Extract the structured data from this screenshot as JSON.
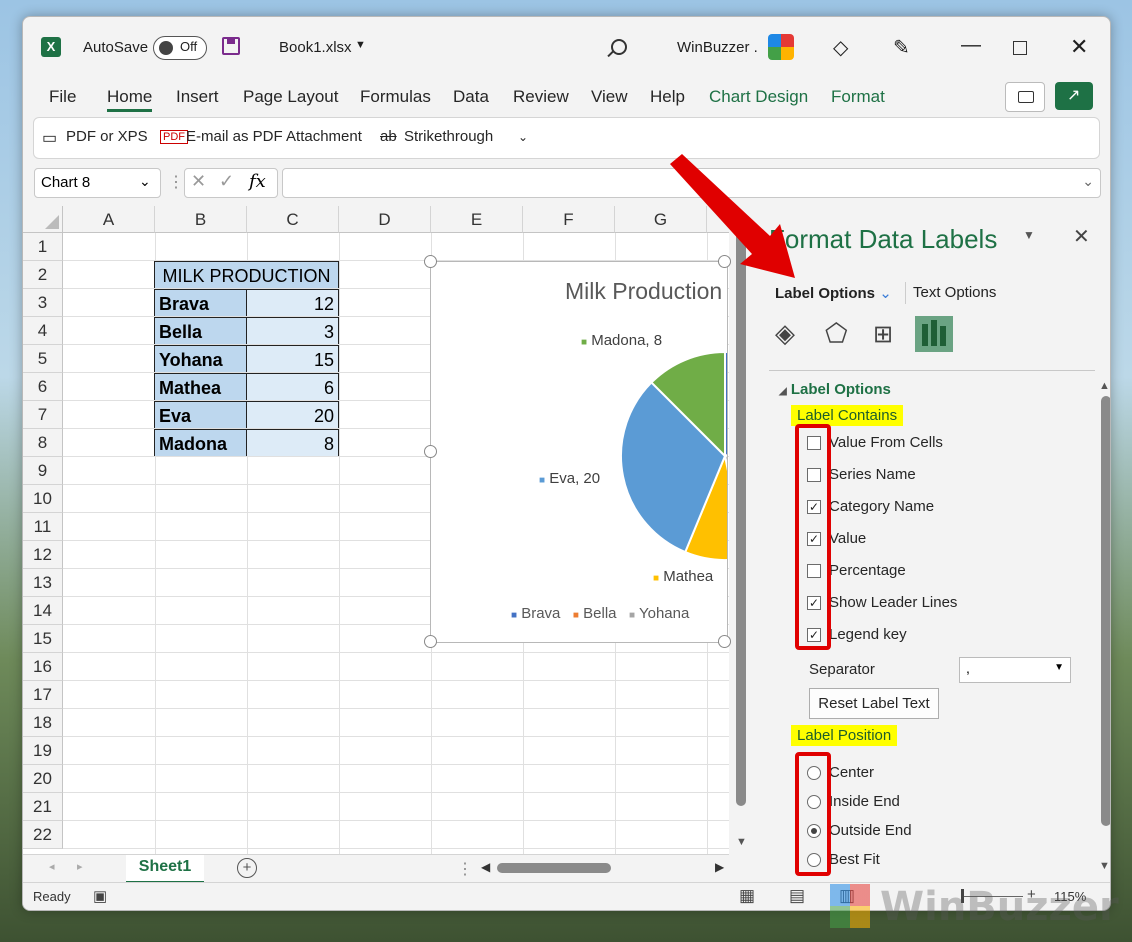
{
  "titlebar": {
    "autosave_label": "AutoSave",
    "autosave_state": "Off",
    "filename": "Book1.xlsx",
    "user": "WinBuzzer ."
  },
  "ribbon_tabs": [
    "File",
    "Home",
    "Insert",
    "Page Layout",
    "Formulas",
    "Data",
    "Review",
    "View",
    "Help",
    "Chart Design",
    "Format"
  ],
  "quick": {
    "pdf_xps": "PDF or XPS",
    "email_pdf": "E-mail as PDF Attachment",
    "strike": "Strikethrough"
  },
  "formula_bar": {
    "name_box": "Chart 8",
    "fx": "fx",
    "formula": ""
  },
  "columns": [
    "A",
    "B",
    "C",
    "D",
    "E",
    "F",
    "G"
  ],
  "rows": [
    "1",
    "2",
    "3",
    "4",
    "5",
    "6",
    "7",
    "8",
    "9",
    "10",
    "11",
    "12",
    "13",
    "14",
    "15",
    "16",
    "17",
    "18",
    "19",
    "20",
    "21",
    "22"
  ],
  "table": {
    "header": "MILK PRODUCTION",
    "rows": [
      {
        "name": "Brava",
        "value": "12"
      },
      {
        "name": "Bella",
        "value": "3"
      },
      {
        "name": "Yohana",
        "value": "15"
      },
      {
        "name": "Mathea",
        "value": "6"
      },
      {
        "name": "Eva",
        "value": "20"
      },
      {
        "name": "Madona",
        "value": "8"
      }
    ]
  },
  "chart_data": {
    "type": "pie",
    "title": "Milk Production",
    "categories": [
      "Brava",
      "Bella",
      "Yohana",
      "Mathea",
      "Eva",
      "Madona"
    ],
    "values": [
      12,
      3,
      15,
      6,
      20,
      8
    ],
    "colors": [
      "#4472c4",
      "#ed7d31",
      "#a5a5a5",
      "#ffc000",
      "#5b9bd5",
      "#70ad47"
    ],
    "data_labels": [
      "Madona, 8",
      "Eva, 20",
      "Mathea"
    ],
    "legend": [
      "Brava",
      "Bella",
      "Yohana"
    ],
    "legend_position": "bottom"
  },
  "panel": {
    "title": "Format Data Labels",
    "tab_label_options": "Label Options",
    "tab_text_options": "Text Options",
    "section": "Label Options",
    "label_contains": "Label Contains",
    "checkboxes": [
      {
        "label": "Value From Cells",
        "checked": false
      },
      {
        "label": "Series Name",
        "checked": false
      },
      {
        "label": "Category Name",
        "checked": true
      },
      {
        "label": "Value",
        "checked": true
      },
      {
        "label": "Percentage",
        "checked": false
      },
      {
        "label": "Show Leader Lines",
        "checked": true
      },
      {
        "label": "Legend key",
        "checked": true
      }
    ],
    "separator_label": "Separator",
    "separator_value": ",",
    "reset_button": "Reset Label Text",
    "label_position": "Label Position",
    "radios": [
      {
        "label": "Center",
        "selected": false
      },
      {
        "label": "Inside End",
        "selected": false
      },
      {
        "label": "Outside End",
        "selected": true
      },
      {
        "label": "Best Fit",
        "selected": false
      }
    ]
  },
  "sheet_tab": "Sheet1",
  "status": {
    "ready": "Ready",
    "zoom": "115%"
  },
  "watermark": "WinBuzzer"
}
